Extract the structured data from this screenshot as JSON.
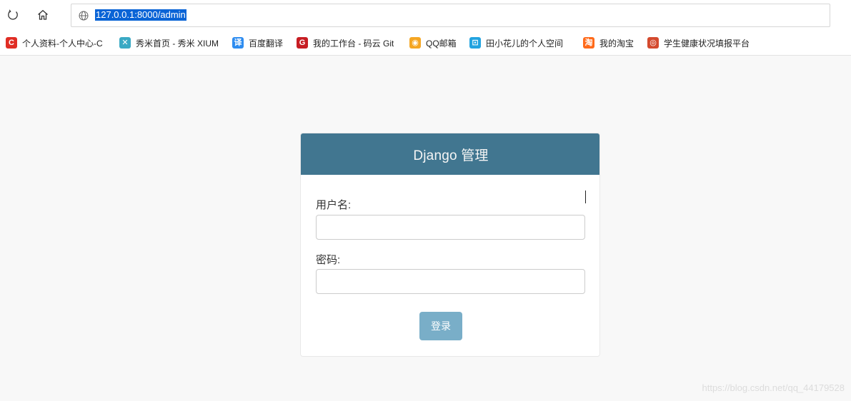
{
  "browser": {
    "url": "127.0.0.1:8000/admin",
    "bookmarks": [
      {
        "label": "个人资料-个人中心-C",
        "icon": "csdn-icon",
        "glyph": "C",
        "color": "#e02d24"
      },
      {
        "label": "秀米首页 - 秀米 XIUM",
        "icon": "xiumi-icon",
        "glyph": "✕",
        "color": "#3aa9c4"
      },
      {
        "label": "百度翻译",
        "icon": "baidu-translate-icon",
        "glyph": "译",
        "color": "#2d8cf0"
      },
      {
        "label": "我的工作台 - 码云 Git",
        "icon": "gitee-icon",
        "glyph": "G",
        "color": "#c71d23"
      },
      {
        "label": "QQ邮箱",
        "icon": "qq-mail-icon",
        "glyph": "◉",
        "color": "#f5a623"
      },
      {
        "label": "田小花儿的个人空间",
        "icon": "bilibili-icon",
        "glyph": "⊡",
        "color": "#22a3e0"
      },
      {
        "label": "我的淘宝",
        "icon": "taobao-icon",
        "glyph": "淘",
        "color": "#ff6a1a"
      },
      {
        "label": "学生健康状况填报平台",
        "icon": "health-report-icon",
        "glyph": "◎",
        "color": "#d44a2e"
      }
    ]
  },
  "login": {
    "title": "Django 管理",
    "username_label": "用户名:",
    "username_value": "",
    "password_label": "密码:",
    "password_value": "",
    "submit_label": "登录",
    "header_color": "#417690",
    "button_color": "#79aec8"
  },
  "watermark": "https://blog.csdn.net/qq_44179528"
}
